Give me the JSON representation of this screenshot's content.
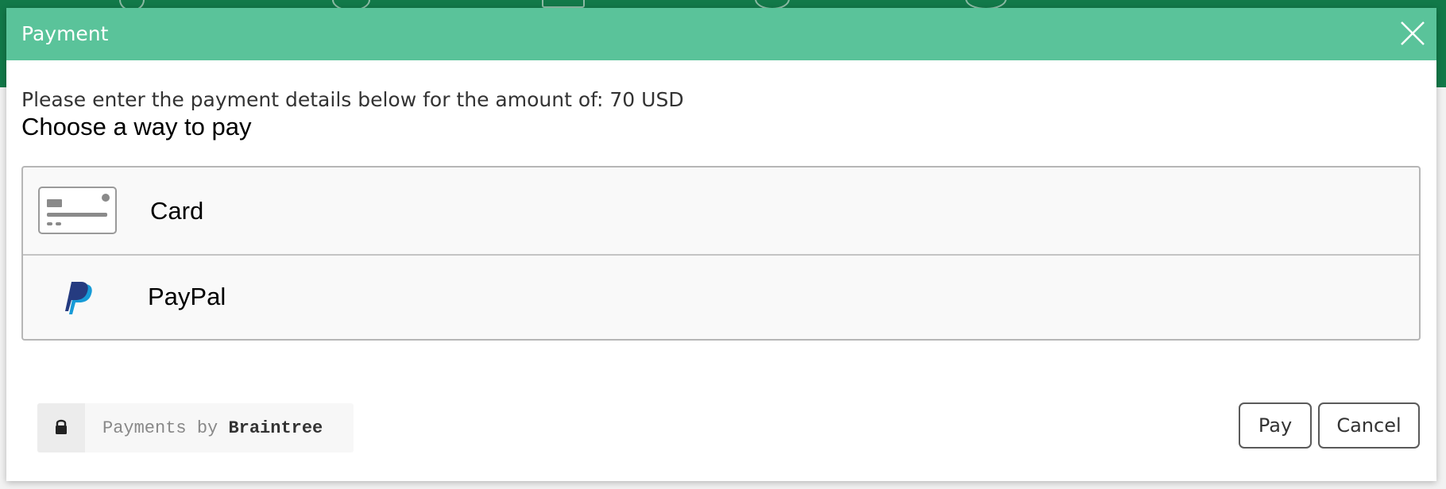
{
  "modal": {
    "title": "Payment",
    "intro_text": "Please enter the payment details below for the amount of: 70 USD",
    "choose_heading": "Choose a way to pay"
  },
  "payment_methods": [
    {
      "label": "Card",
      "icon": "credit-card-icon"
    },
    {
      "label": "PayPal",
      "icon": "paypal-logo-icon"
    }
  ],
  "braintree_badge": {
    "prefix": "Payments by ",
    "brand": "Braintree",
    "icon": "lock-icon"
  },
  "buttons": {
    "pay_label": "Pay",
    "cancel_label": "Cancel"
  },
  "colors": {
    "header_green": "#5ac39a",
    "backdrop_green": "#13804d",
    "paypal_dark": "#253b80",
    "paypal_light": "#179bd7"
  }
}
